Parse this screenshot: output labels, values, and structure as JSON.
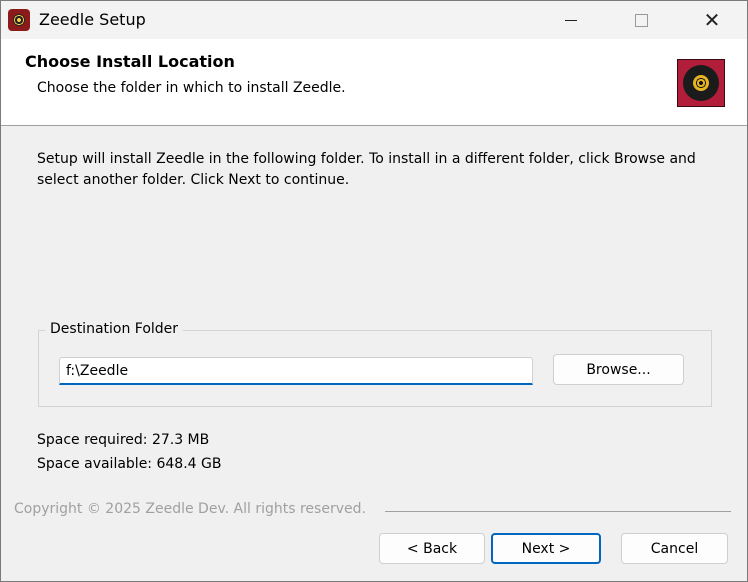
{
  "window": {
    "title": "Zeedle Setup",
    "icon": "zeedle-app-icon"
  },
  "titlebar": {
    "minimize_icon": "minimize-icon",
    "maximize_icon": "maximize-icon",
    "close_glyph": "✕"
  },
  "header": {
    "title": "Choose Install Location",
    "subtitle": "Choose the folder in which to install Zeedle.",
    "logo": "vinyl-record-logo"
  },
  "body": {
    "intro": "Setup will install Zeedle in the following folder. To install in a different folder, click Browse and select another folder. Click Next to continue."
  },
  "destination": {
    "group_label": "Destination Folder",
    "path_value": "f:\\Zeedle",
    "browse_label": "Browse..."
  },
  "space": {
    "required": "Space required: 27.3 MB",
    "available": "Space available: 648.4 GB"
  },
  "footer": {
    "copyright": "Copyright © 2025 Zeedle Dev. All rights reserved.",
    "back_label": "< Back",
    "next_label": "Next >",
    "cancel_label": "Cancel"
  },
  "colors": {
    "accent": "#0067c0",
    "logo_red": "#b21e3a",
    "background": "#f0f0f0"
  }
}
